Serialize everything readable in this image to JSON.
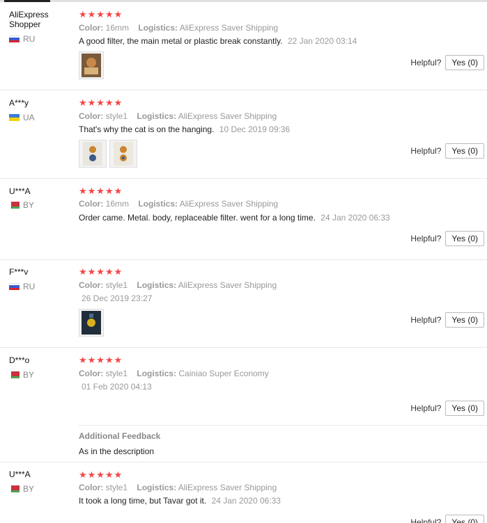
{
  "labels": {
    "color": "Color:",
    "logistics": "Logistics:",
    "helpful": "Helpful?",
    "stars": "★★★★★"
  },
  "reviews": [
    {
      "user": "AliExpress Shopper",
      "country": "RU",
      "color": "16mm",
      "logistics": "AliExpress Saver Shipping",
      "text": "A good filter, the main metal or plastic break constantly.",
      "date": "22 Jan 2020 03:14",
      "helpful": "Yes (0)"
    },
    {
      "user": "A***y",
      "country": "UA",
      "color": "style1",
      "logistics": "AliExpress Saver Shipping",
      "text": "That's why the cat is on the hanging.",
      "date": "10 Dec 2019 09:36",
      "helpful": "Yes (0)"
    },
    {
      "user": "U***A",
      "country": "BY",
      "color": "16mm",
      "logistics": "AliExpress Saver Shipping",
      "text": "Order came. Metal. body, replaceable filter. went for a long time.",
      "date": "24 Jan 2020 06:33",
      "helpful": "Yes (0)"
    },
    {
      "user": "F***v",
      "country": "RU",
      "color": "style1",
      "logistics": "AliExpress Saver Shipping",
      "text": "",
      "date": "26 Dec 2019 23:27",
      "helpful": "Yes (0)"
    },
    {
      "user": "D***o",
      "country": "BY",
      "color": "style1",
      "logistics": "Cainiao Super Economy",
      "text": "",
      "date": "01 Feb 2020 04:13",
      "helpful": "Yes (0)",
      "additional_label": "Additional Feedback",
      "additional_text": "As in the description"
    },
    {
      "user": "U***A",
      "country": "BY",
      "color": "style1",
      "logistics": "AliExpress Saver Shipping",
      "text": "It took a long time, but Tavar got it.",
      "date": "24 Jan 2020 06:33",
      "helpful": "Yes (0)"
    }
  ]
}
